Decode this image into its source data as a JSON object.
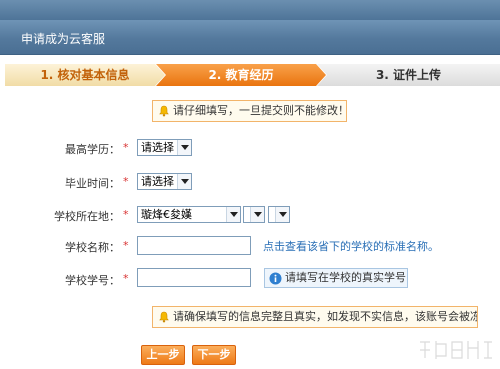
{
  "header": {
    "title": "申请成为云客服"
  },
  "steps": [
    {
      "label": "1. 核对基本信息",
      "state": "done"
    },
    {
      "label": "2. 教育经历",
      "state": "active"
    },
    {
      "label": "3. 证件上传",
      "state": "pending"
    }
  ],
  "notice_top": {
    "icon": "bell-icon",
    "text": "请仔细填写，一旦提交则不能修改！"
  },
  "form": {
    "education": {
      "label": "最高学历：",
      "required_mark": "*",
      "value": "请选择"
    },
    "graduation_time": {
      "label": "毕业时间：",
      "required_mark": "*",
      "value": "请选择"
    },
    "school_location": {
      "label": "学校所在地：",
      "required_mark": "*",
      "province_value": "璇烽€夋嫨",
      "city_value": "",
      "district_value": ""
    },
    "school_name": {
      "label": "学校名称：",
      "required_mark": "*",
      "value": "",
      "hint": "点击查看该省下的学校的标准名称。"
    },
    "student_id": {
      "label": "学校学号：",
      "required_mark": "*",
      "value": "",
      "tip": "请填写在学校的真实学号"
    }
  },
  "notice_bottom": {
    "icon": "bell-icon",
    "text": "请确保填写的信息完整且真实，如发现不实信息，该账号会被冻结"
  },
  "buttons": {
    "prev": "上一步",
    "next": "下一步"
  },
  "colors": {
    "header_bg": "#54799d",
    "active_step": "#ef7b17",
    "done_step_text": "#c2620a",
    "required": "#d83333",
    "link": "#2a6fb6",
    "notice_border": "#f2b46a"
  }
}
